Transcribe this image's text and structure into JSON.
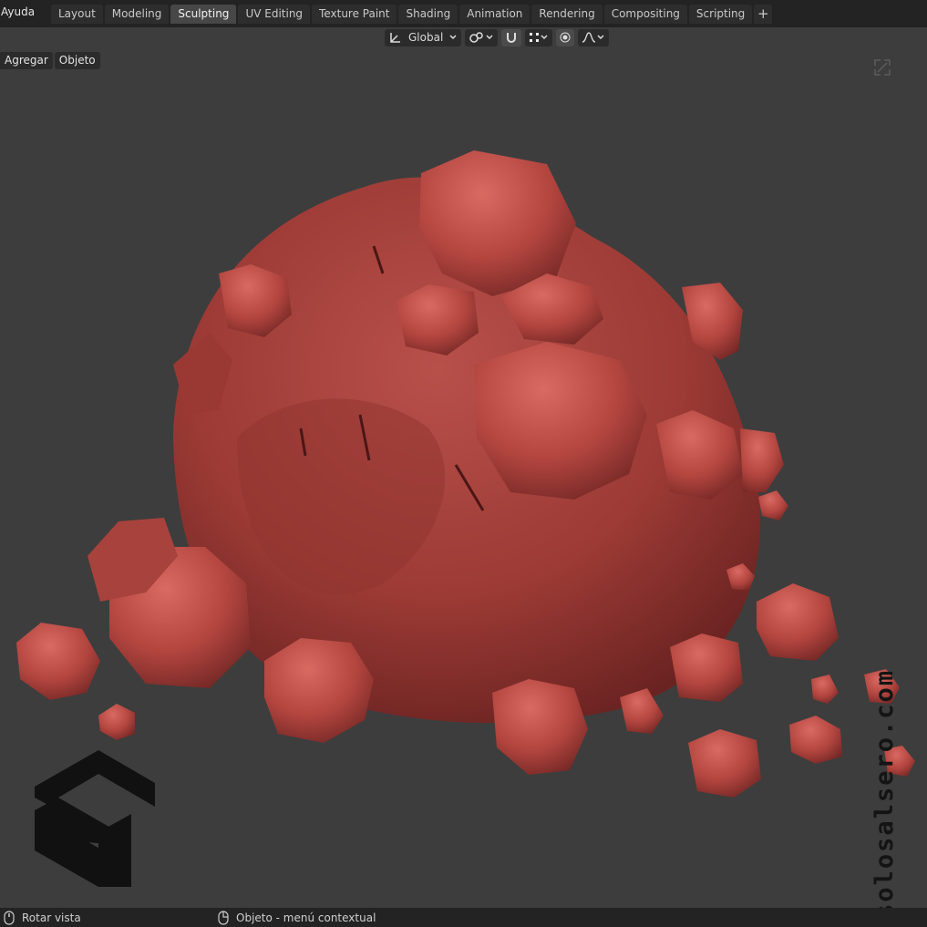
{
  "topbar": {
    "menu": "Ayuda",
    "tabs": [
      "Layout",
      "Modeling",
      "Sculpting",
      "UV Editing",
      "Texture Paint",
      "Shading",
      "Animation",
      "Rendering",
      "Compositing",
      "Scripting"
    ],
    "active_tab": "Sculpting",
    "add_tab": "+"
  },
  "header": {
    "orientation": "Global"
  },
  "viewport": {
    "buttons": [
      "Agregar",
      "Objeto"
    ],
    "watermark": "solosalsero.com"
  },
  "status": {
    "left": "Rotar vista",
    "middle": "Objeto - menú contextual"
  },
  "colors": {
    "rock": "#a63d37",
    "background": "#3d3d3d"
  }
}
